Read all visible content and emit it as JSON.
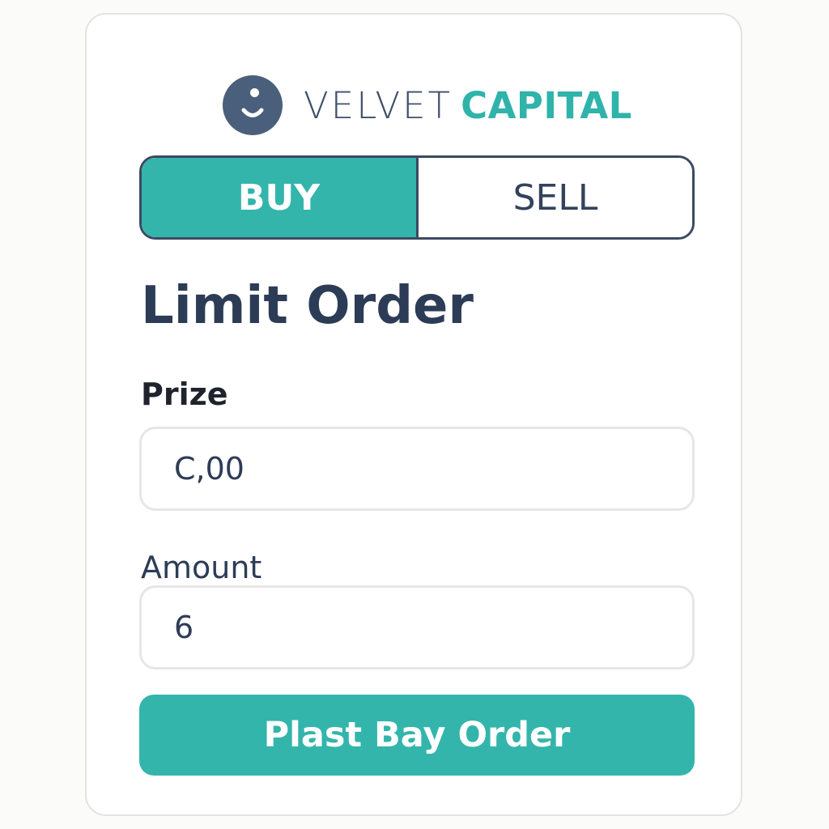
{
  "brand": {
    "name_part1": "VELVET",
    "name_part2": "CAPITAL",
    "logo_icon": "smiley-face-icon",
    "colors": {
      "dark": "#4a5f7b",
      "accent": "#2fb3aa"
    }
  },
  "order_side": {
    "buy_label": "BUY",
    "sell_label": "SELL",
    "selected": "BUY"
  },
  "form": {
    "title": "Limit Order",
    "price_label": "Prize",
    "price_value": "C,00",
    "amount_label": "Amount",
    "amount_value": "6",
    "submit_label": "Plast Bay Order"
  }
}
